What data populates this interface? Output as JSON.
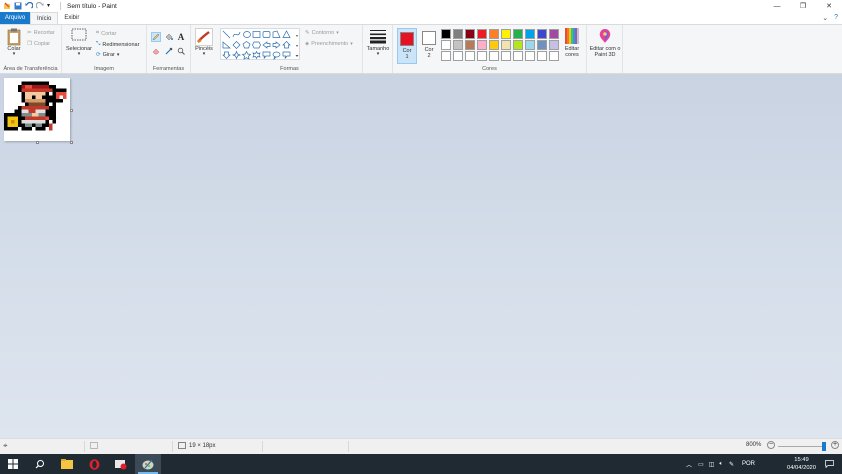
{
  "window": {
    "title": "Sem título - Paint",
    "controls": [
      "minimize-icon",
      "restore-icon",
      "close-icon"
    ]
  },
  "tabs": [
    {
      "label": "Arquivo",
      "active": false
    },
    {
      "label": "Início",
      "active": true
    },
    {
      "label": "Exibir",
      "active": false
    }
  ],
  "ribbon": {
    "clipboard": {
      "label": "Área de Transferência",
      "paste": "Colar",
      "cut": "Recortar",
      "copy": "Copiar"
    },
    "image": {
      "label": "Imagem",
      "select": "Selecionar",
      "crop": "Cortar",
      "resize": "Redimensionar",
      "rotate": "Girar"
    },
    "tools": {
      "label": "Ferramentas",
      "brushes": "Pincéis"
    },
    "shapes": {
      "label": "Formas",
      "outline": "Contorno",
      "fill": "Preenchimento"
    },
    "size": {
      "label": "Tamanho"
    },
    "colors": {
      "label": "Cores",
      "color1": {
        "label": "Cor",
        "index": "1",
        "value": "#e81123",
        "selected": true
      },
      "color2": {
        "label": "Cor",
        "index": "2",
        "value": "#ffffff",
        "selected": false
      },
      "edit_colors": "Editar cores",
      "edit_paint3d": "Editar com o Paint 3D",
      "palette": [
        "#000000",
        "#7f7f7f",
        "#880015",
        "#ed1c24",
        "#ff7f27",
        "#fff200",
        "#22b14c",
        "#00a2e8",
        "#3f48cc",
        "#a349a4",
        "#ffffff",
        "#c3c3c3",
        "#b97a57",
        "#ffaec9",
        "#ffc90e",
        "#efe4b0",
        "#b5e61d",
        "#99d9ea",
        "#7092be",
        "#c8bfe7",
        "#ffffff",
        "#ffffff",
        "#ffffff",
        "#ffffff",
        "#ffffff",
        "#ffffff",
        "#ffffff",
        "#ffffff",
        "#ffffff",
        "#ffffff"
      ]
    }
  },
  "statusbar": {
    "image_size": "19 × 18px",
    "zoom": "800%"
  },
  "taskbar": {
    "apps": [
      "windows-start-icon",
      "search-icon",
      "file-explorer-icon",
      "opera-icon",
      "media-icon",
      "paint-icon"
    ],
    "language": "POR",
    "time": "15:49",
    "date": "04/04/2020"
  }
}
